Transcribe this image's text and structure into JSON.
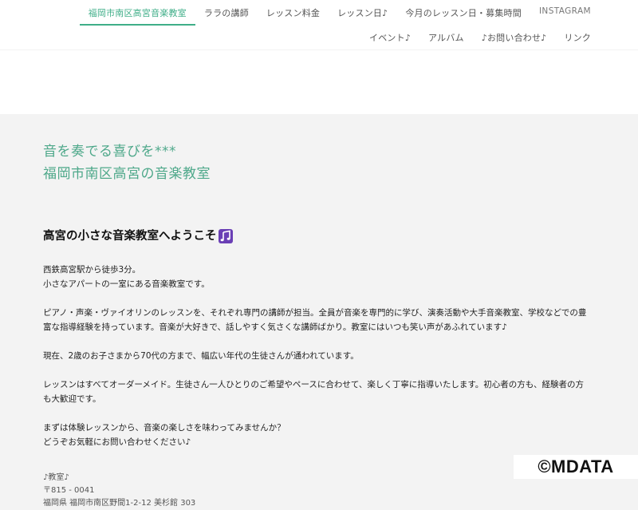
{
  "nav": {
    "row1": [
      {
        "label": "福岡市南区高宮音楽教室",
        "active": true
      },
      {
        "label": "ララの講師"
      },
      {
        "label": "レッスン料金"
      },
      {
        "label": "レッスン日♪"
      },
      {
        "label": "今月のレッスン日・募集時間"
      },
      {
        "label": "INSTAGRAM"
      }
    ],
    "row2": [
      {
        "label": "イベント♪"
      },
      {
        "label": "アルバム"
      },
      {
        "label": "♪お問い合わせ♪"
      },
      {
        "label": "リンク"
      }
    ]
  },
  "hero": {
    "line1": "音を奏でる喜びを***",
    "line2": "福岡市南区高宮の音楽教室"
  },
  "welcome": {
    "title": "高宮の小さな音楽教室へようこそ"
  },
  "paragraphs": [
    [
      "西鉄高宮駅から徒歩3分。",
      "小さなアパートの一室にある音楽教室です。"
    ],
    [
      "ピアノ・声楽・ヴァイオリンのレッスンを、それぞれ専門の講師が担当。全員が音楽を専門的に学び、演奏活動や大手音楽教室、学校などでの豊",
      "富な指導経験を持っています。音楽が大好きで、話しやすく気さくな講師ばかり。教室にはいつも笑い声があふれています♪"
    ],
    [
      "現在、2歳のお子さまから70代の方まで、幅広い年代の生徒さんが通われています。"
    ],
    [
      "レッスンはすべてオーダーメイド。生徒さん一人ひとりのご希望やペースに合わせて、楽しく丁寧に指導いたします。初心者の方も、経験者の方",
      "も大歓迎です。"
    ],
    [
      "まずは体験レッスンから、音楽の楽しさを味わってみませんか？",
      "どうぞお気軽にお問い合わせください♪"
    ]
  ],
  "address": {
    "label": "♪教室♪",
    "postal": "〒815 - 0041",
    "street": "福岡県 福岡市南区野間1-2-12 美杉館 303"
  },
  "watermark": "©MDATA",
  "colors": {
    "accent": "#4ea88a",
    "nav_active": "#3fae88"
  },
  "icons": {
    "welcome_icon": "music-notes-icon"
  }
}
